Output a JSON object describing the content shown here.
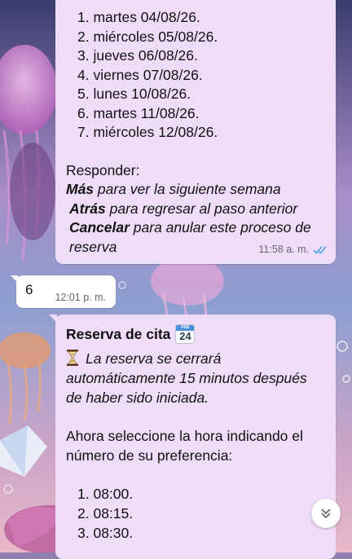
{
  "colors": {
    "bubble_incoming": "#efdcf8",
    "bubble_outgoing": "#ffffff",
    "read_ticks": "#53a6e7",
    "wallpaper_accent": "#c873c8"
  },
  "messages": {
    "days": {
      "items": [
        "1. martes 04/08/26.",
        "2. miércoles 05/08/26.",
        "3. jueves 06/08/26.",
        "4. viernes 07/08/26.",
        "5. lunes 10/08/26.",
        "6. martes 11/08/26.",
        "7. miércoles 12/08/26."
      ],
      "reply_header": "Responder:",
      "options": [
        {
          "keyword": "Más",
          "text": " para ver la siguiente semana"
        },
        {
          "keyword": "Atrás",
          "text": " para regresar al paso anterior"
        },
        {
          "keyword": "Cancelar",
          "text": " para anular este proceso de reserva"
        }
      ],
      "time": "11:58 a. m.",
      "status_icon": "double-check-icon"
    },
    "user_reply": {
      "text": "6",
      "time": "12:01 p. m."
    },
    "reserva": {
      "title": "Reserva de cita",
      "calendar_icon": {
        "month": "FEB",
        "day": "24"
      },
      "warning_icon": "hourglass-icon",
      "warning_text": "La reserva se cerrará automáticamente 15 minutos después de haber sido iniciada.",
      "prompt": "Ahora seleccione la hora indicando el número de su preferencia:",
      "times": [
        "1. 08:00.",
        "2. 08:15.",
        "3. 08:30."
      ]
    }
  },
  "scroll_button_icon": "chevron-double-down-icon"
}
